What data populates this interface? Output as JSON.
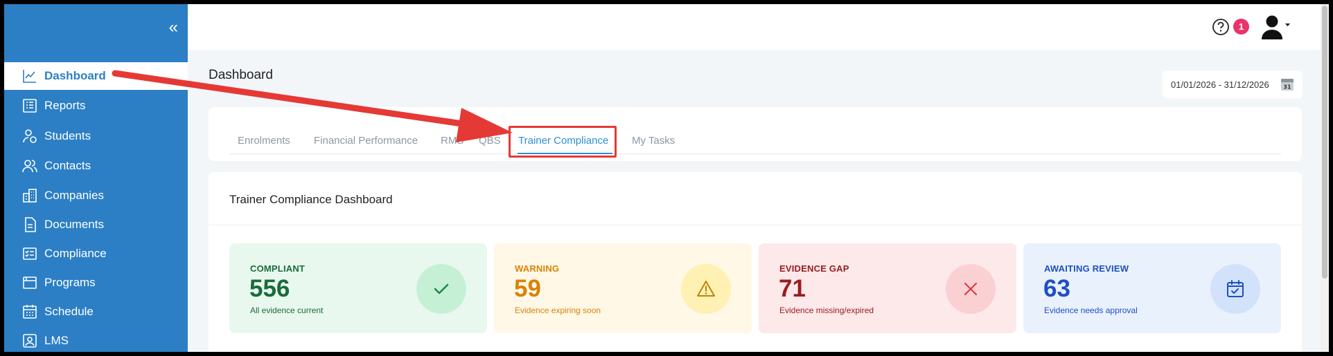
{
  "sidebar": {
    "collapse_icon": "double-chevron-left-icon",
    "items": [
      {
        "label": "Dashboard",
        "icon": "line-chart-icon"
      },
      {
        "label": "Reports",
        "icon": "report-list-icon"
      },
      {
        "label": "Students",
        "icon": "student-icon"
      },
      {
        "label": "Contacts",
        "icon": "contacts-icon"
      },
      {
        "label": "Companies",
        "icon": "building-icon"
      },
      {
        "label": "Documents",
        "icon": "document-icon"
      },
      {
        "label": "Compliance",
        "icon": "checklist-icon"
      },
      {
        "label": "Programs",
        "icon": "programs-icon"
      },
      {
        "label": "Schedule",
        "icon": "calendar-grid-icon"
      },
      {
        "label": "LMS",
        "icon": "lms-icon"
      }
    ]
  },
  "topbar": {
    "notification_count": "1",
    "help_icon": "question-circle-icon",
    "avatar_icon": "user-icon"
  },
  "page": {
    "title": "Dashboard",
    "date_range": "01/01/2026 - 31/12/2026",
    "calendar_day": "31"
  },
  "tabs": [
    {
      "label": "Enrolments"
    },
    {
      "label": "Financial Performance"
    },
    {
      "label": "RMS"
    },
    {
      "label": "QBS"
    },
    {
      "label": "Trainer Compliance"
    },
    {
      "label": "My Tasks"
    }
  ],
  "dashboard": {
    "title": "Trainer Compliance Dashboard",
    "stats": [
      {
        "label": "COMPLIANT",
        "value": "556",
        "sub": "All evidence current",
        "icon": "check-icon",
        "bg": "#e8f8ee",
        "fg": "#1a6b3a",
        "circle": "#c6f0d5"
      },
      {
        "label": "WARNING",
        "value": "59",
        "sub": "Evidence expiring soon",
        "icon": "warning-triangle-icon",
        "bg": "#fff8e6",
        "fg": "#d9820a",
        "circle": "#fff0b3"
      },
      {
        "label": "EVIDENCE GAP",
        "value": "71",
        "sub": "Evidence missing/expired",
        "icon": "x-icon",
        "bg": "#fde9ea",
        "fg": "#9b1c22",
        "circle": "#fbd0d3"
      },
      {
        "label": "AWAITING REVIEW",
        "value": "63",
        "sub": "Evidence needs approval",
        "icon": "calendar-check-icon",
        "bg": "#e9f1fd",
        "fg": "#1d4fc4",
        "circle": "#d3e2fb"
      }
    ]
  },
  "colors": {
    "sidebar": "#2c7fc5",
    "accent": "#2c8fd6",
    "annotation": "#e53935"
  }
}
